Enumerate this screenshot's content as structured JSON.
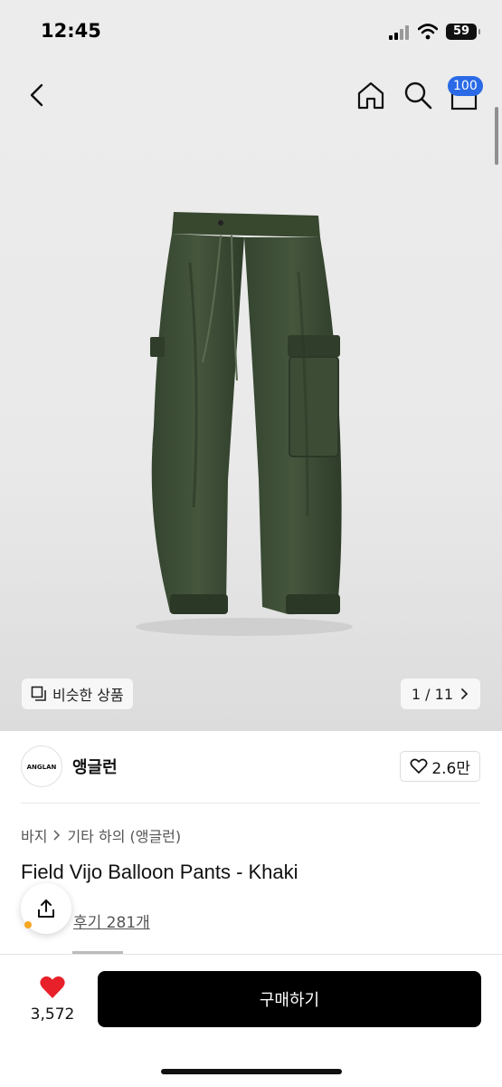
{
  "status_bar": {
    "time": "12:45",
    "battery": "59"
  },
  "nav": {
    "back_icon": "chevron-left-icon",
    "home_icon": "home-icon",
    "search_icon": "search-icon",
    "bag_icon": "shopping-bag-icon",
    "cart_count": "100"
  },
  "hero": {
    "similar_label": "비슷한 상품",
    "page_indicator": "1 / 11"
  },
  "brand": {
    "logo_text": "ANGLAN",
    "name": "앵글런",
    "likes": "2.6만"
  },
  "breadcrumb": [
    "바지",
    "기타 하의 (앵글런)"
  ],
  "product": {
    "title": "Field Vijo Balloon Pants - Khaki",
    "reviews": "후기 281개"
  },
  "bottom_bar": {
    "wish_count": "3,572",
    "buy_label": "구매하기"
  },
  "colors": {
    "accent_badge": "#2a6ae6",
    "heart": "#e8202a",
    "buy_button": "#000000",
    "pants": "#3a4a33"
  }
}
